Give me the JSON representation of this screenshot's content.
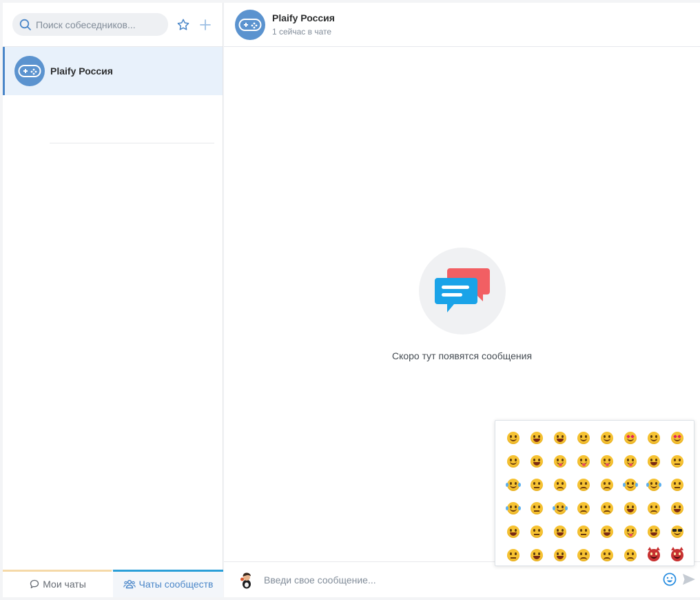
{
  "sidebar": {
    "search_placeholder": "Поиск собеседников...",
    "chats": [
      {
        "name": "Plaify Россия",
        "active": true
      }
    ],
    "tabs": {
      "my_chats": "Мои чаты",
      "community_chats": "Чаты сообществ",
      "active": "community_chats"
    }
  },
  "chat": {
    "title": "Plaify Россия",
    "subtitle": "1 сейчас в чате",
    "empty_text": "Скоро тут появятся сообщения",
    "input_placeholder": "Введи свое сообщение..."
  },
  "emoji_panel": {
    "rows": [
      [
        "smile",
        "grin",
        "grimace",
        "happy",
        "wink",
        "heart-eyes",
        "kiss",
        "kiss-heart"
      ],
      [
        "kiss-closed",
        "kiss-surprised",
        "tongue-wink",
        "tongue-closed",
        "tongue",
        "crazy",
        "laugh",
        "smirk"
      ],
      [
        "sweat",
        "unamused",
        "frown",
        "disappointed",
        "confused",
        "joy",
        "cry",
        "sleepy"
      ],
      [
        "tears",
        "relieved",
        "sob",
        "weary",
        "worried",
        "yawn",
        "anxious",
        "fearful"
      ],
      [
        "angry",
        "neutral-open",
        "astonished",
        "blank",
        "beam",
        "drool",
        "scream",
        "sunglasses"
      ],
      [
        "expressionless",
        "dizzy",
        "hushed",
        "sad-open",
        "persevere",
        "tired",
        "imp",
        "devil"
      ]
    ]
  },
  "colors": {
    "accent": "#4a86c8",
    "active_chat_bg": "#e8f1fb",
    "avatar_bg": "#5b93cf",
    "bubble_blue": "#1aa3e8",
    "bubble_red": "#f25f63"
  }
}
